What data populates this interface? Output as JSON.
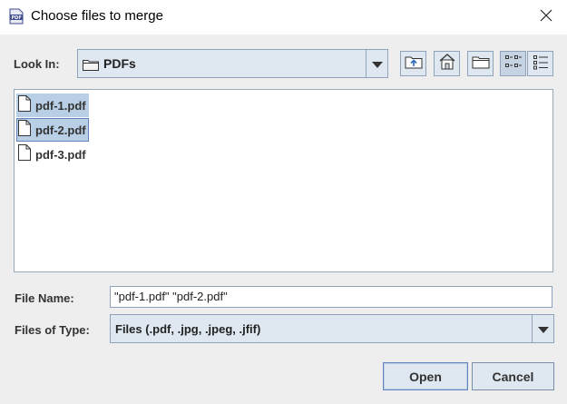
{
  "window": {
    "title": "Choose files to merge"
  },
  "look_in": {
    "label": "Look In:",
    "value": "PDFs"
  },
  "toolbar": [
    {
      "name": "up-one-level-button",
      "icon": "up-folder-icon"
    },
    {
      "name": "home-button",
      "icon": "home-icon"
    },
    {
      "name": "new-folder-button",
      "icon": "new-folder-icon"
    },
    {
      "name": "list-view-button",
      "icon": "list-view-icon",
      "selected": true
    },
    {
      "name": "details-view-button",
      "icon": "details-view-icon",
      "selected": false
    }
  ],
  "files": [
    {
      "name": "pdf-1.pdf",
      "selected": true
    },
    {
      "name": "pdf-2.pdf",
      "selected": true,
      "focused": true
    },
    {
      "name": "pdf-3.pdf",
      "selected": false
    }
  ],
  "file_name": {
    "label": "File Name:",
    "value": "\"pdf-1.pdf\" \"pdf-2.pdf\""
  },
  "file_type": {
    "label": "Files of Type:",
    "value": "Files (.pdf, .jpg, .jpeg, .jfif)"
  },
  "buttons": {
    "open": "Open",
    "cancel": "Cancel"
  },
  "colors": {
    "accent": "#6382bf",
    "selection": "#b8cfe5",
    "button_bg": "#dfe7f1",
    "panel_bg": "#eeeeee"
  }
}
